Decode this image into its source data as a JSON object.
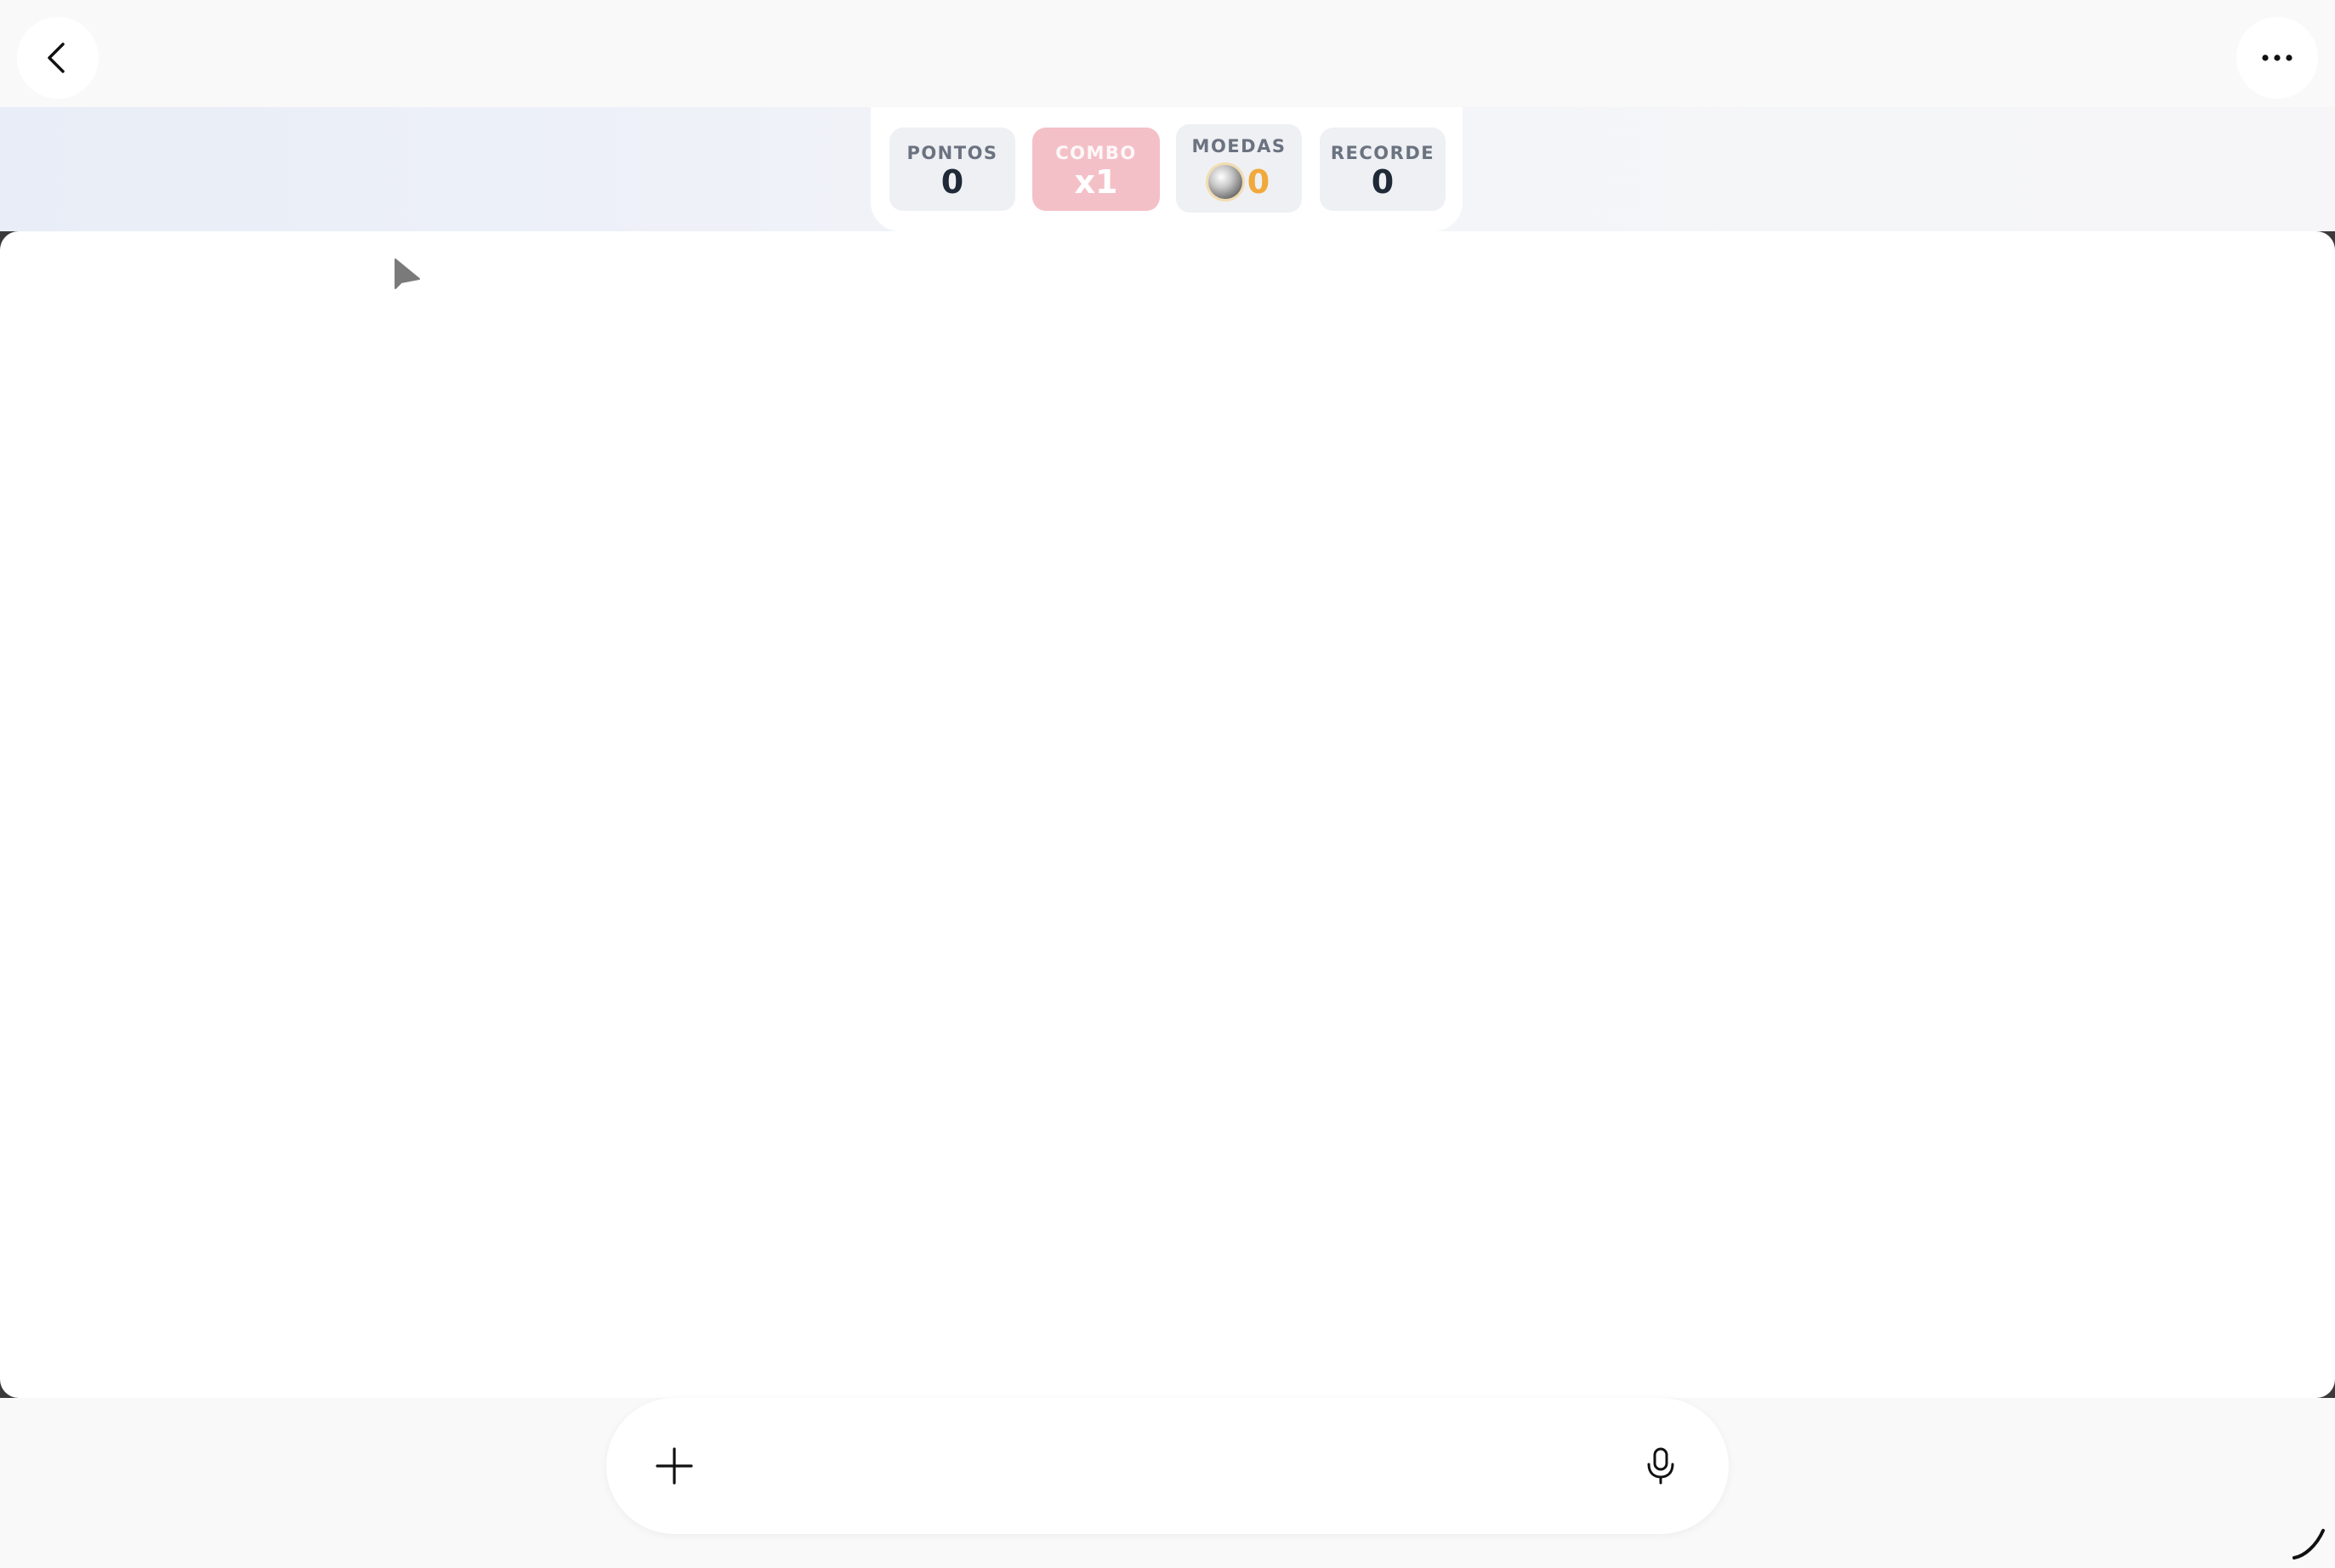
{
  "topbar": {
    "back_icon": "chevron-left-icon",
    "more_icon": "more-horizontal-icon"
  },
  "hud": {
    "score": {
      "label": "PONTOS",
      "value": "0"
    },
    "combo": {
      "label": "COMBO",
      "value": "x1"
    },
    "coins": {
      "label": "MOEDAS",
      "value": "0",
      "icon": "coin-icon"
    },
    "record": {
      "label": "RECORDE",
      "value": "0"
    }
  },
  "colors": {
    "combo_bg": "#f4c0c7",
    "coin_value": "#f0a93a",
    "stat_bg": "#eef0f3",
    "label_gray": "#6b7280",
    "value_dark": "#1f2937"
  },
  "canvas": {
    "pointer_icon": "player-arrow-icon"
  },
  "composer": {
    "add_icon": "plus-icon",
    "mic_icon": "microphone-icon"
  }
}
